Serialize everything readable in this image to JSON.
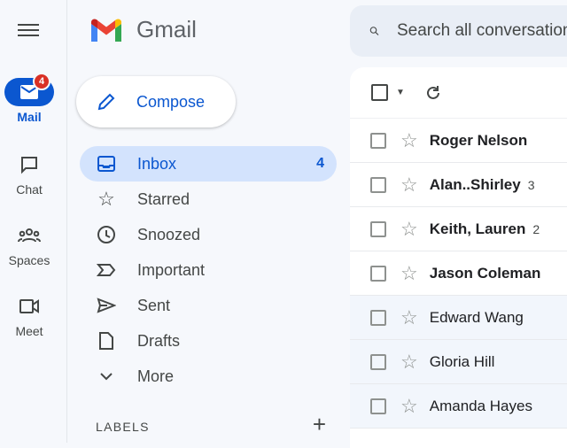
{
  "app": {
    "title": "Gmail"
  },
  "rail": [
    {
      "label": "Mail",
      "badge": "4",
      "icon": "mail-icon"
    },
    {
      "label": "Chat",
      "icon": "chat-icon"
    },
    {
      "label": "Spaces",
      "icon": "spaces-icon"
    },
    {
      "label": "Meet",
      "icon": "meet-icon"
    }
  ],
  "compose": {
    "label": "Compose"
  },
  "nav": [
    {
      "label": "Inbox",
      "count": "4"
    },
    {
      "label": "Starred"
    },
    {
      "label": "Snoozed"
    },
    {
      "label": "Important"
    },
    {
      "label": "Sent"
    },
    {
      "label": "Drafts"
    },
    {
      "label": "More"
    }
  ],
  "labels": {
    "title": "LABELS",
    "add": "+"
  },
  "search": {
    "placeholder": "Search all conversations"
  },
  "messages": [
    {
      "sender": "Roger Nelson",
      "count": ""
    },
    {
      "sender": "Alan..Shirley",
      "count": "3"
    },
    {
      "sender": "Keith, Lauren",
      "count": "2"
    },
    {
      "sender": "Jason Coleman",
      "count": ""
    },
    {
      "sender": "Edward Wang",
      "count": ""
    },
    {
      "sender": "Gloria Hill",
      "count": ""
    },
    {
      "sender": "Amanda Hayes",
      "count": ""
    }
  ],
  "colors": {
    "accent": "#0b57d0",
    "badge": "#d93025",
    "active_nav": "#d3e3fd"
  }
}
